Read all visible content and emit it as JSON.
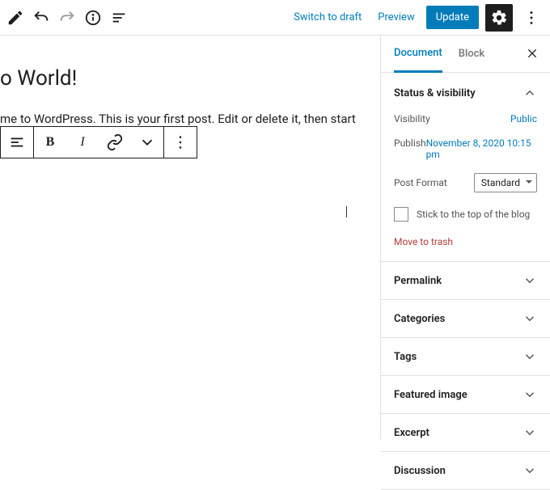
{
  "header": {
    "switch_draft": "Switch to draft",
    "preview": "Preview",
    "update": "Update"
  },
  "post": {
    "title": "o World!",
    "body": "me to WordPress. This is your first post. Edit or delete it, then start writing!"
  },
  "toolbar": {
    "bold": "B",
    "italic": "I"
  },
  "sidebar": {
    "tabs": {
      "document": "Document",
      "block": "Block"
    },
    "status": {
      "heading": "Status & visibility",
      "visibility_label": "Visibility",
      "visibility_value": "Public",
      "publish_label": "Publish",
      "publish_value": "November 8, 2020 10:15 pm",
      "post_format_label": "Post Format",
      "post_format_value": "Standard",
      "stick_label": "Stick to the top of the blog",
      "trash_label": "Move to trash"
    },
    "panels": {
      "permalink": "Permalink",
      "categories": "Categories",
      "tags": "Tags",
      "featured_image": "Featured image",
      "excerpt": "Excerpt",
      "discussion": "Discussion"
    }
  }
}
